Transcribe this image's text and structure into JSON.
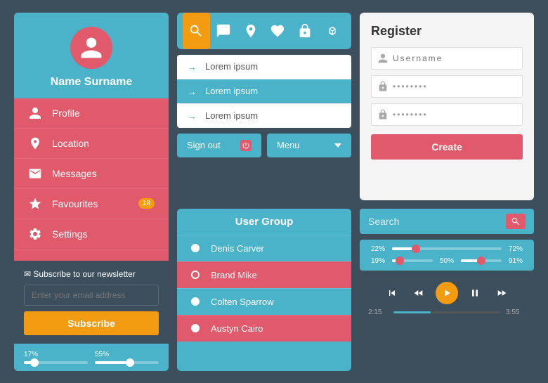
{
  "user": {
    "name": "Name Surname"
  },
  "nav": {
    "items": [
      {
        "label": "Profile",
        "icon": "profile"
      },
      {
        "label": "Location",
        "icon": "location"
      },
      {
        "label": "Messages",
        "icon": "messages"
      },
      {
        "label": "Favourites",
        "icon": "star",
        "badge": "18"
      },
      {
        "label": "Settings",
        "icon": "settings"
      }
    ]
  },
  "newsletter": {
    "title": "Subscribe to our newsletter",
    "placeholder": "Enter your email address",
    "button": "Subscribe"
  },
  "progress": {
    "p1": "17%",
    "p2": "55%",
    "p1val": 17,
    "p2val": 55
  },
  "iconbar": {
    "icons": [
      "search",
      "chat",
      "location",
      "heart",
      "lock",
      "cube"
    ]
  },
  "dropdown": {
    "items": [
      "Lorem ipsum",
      "Lorem ipsum",
      "Lorem ipsum"
    ],
    "activeIndex": 1
  },
  "buttons": {
    "signout": "Sign out",
    "menu": "Menu"
  },
  "usergroup": {
    "title": "User Group",
    "members": [
      {
        "name": "Denis Carver",
        "filled": true
      },
      {
        "name": "Brand Mike",
        "filled": false
      },
      {
        "name": "Colten Sparrow",
        "filled": true
      },
      {
        "name": "Austyn Cairo",
        "filled": true
      }
    ]
  },
  "register": {
    "title": "Register",
    "username_placeholder": "Username",
    "password_placeholder": "••••••••",
    "create_button": "Create"
  },
  "search": {
    "placeholder": "Search",
    "label": "Search"
  },
  "sliders": [
    {
      "left": "22%",
      "right": "72%",
      "leftVal": 22,
      "rightVal": 72
    },
    {
      "left": "19%",
      "mid": "50%",
      "right": "91%",
      "leftVal": 19,
      "midVal": 50,
      "rightVal": 91
    }
  ],
  "player": {
    "current": "2:15",
    "total": "3:55"
  }
}
